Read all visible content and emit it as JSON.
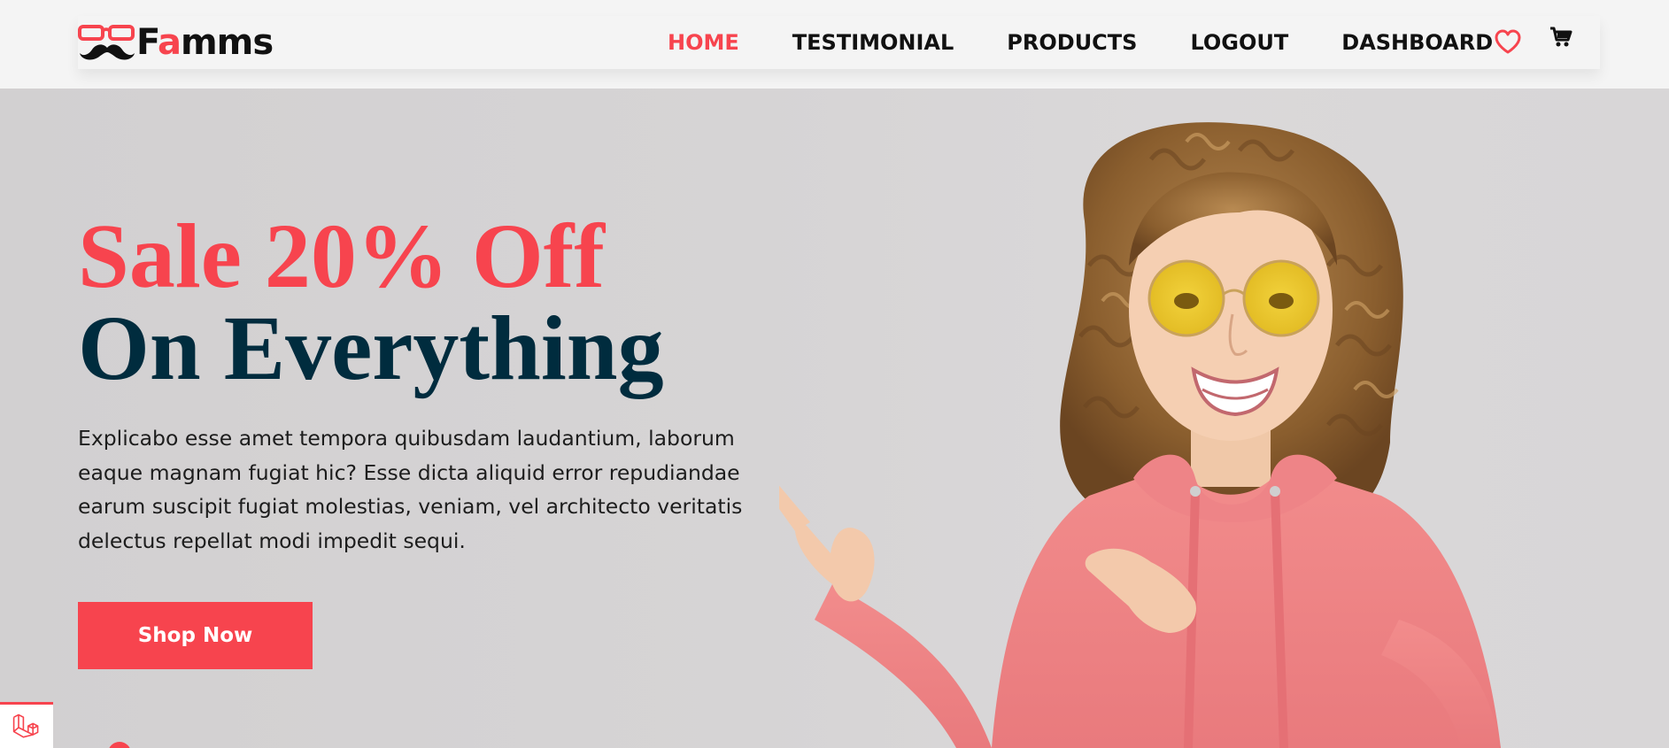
{
  "brand": {
    "name_prefix": "F",
    "name_accent": "a",
    "name_suffix": "mms",
    "logo_icon": "glasses-mustache-icon"
  },
  "nav": {
    "items": [
      {
        "label": "HOME",
        "active": true
      },
      {
        "label": "TESTIMONIAL",
        "active": false
      },
      {
        "label": "PRODUCTS",
        "active": false
      },
      {
        "label": "LOGOUT",
        "active": false
      },
      {
        "label": "DASHBOARD",
        "active": false
      }
    ],
    "icons": [
      "heart-icon",
      "cart-icon"
    ]
  },
  "hero": {
    "title_line1": "Sale 20% Off",
    "title_line2": "On Everything",
    "description": "Explicabo esse amet tempora quibusdam laudantium, laborum eaque magnam fugiat hic? Esse dicta aliquid error repudiandae earum suscipit fugiat molestias, veniam, vel architecto veritatis delectus repellat modi impedit sequi.",
    "cta_label": "Shop Now"
  },
  "colors": {
    "accent": "#f7444e",
    "heading_dark": "#002c3e",
    "hero_background": "#d6d4d5",
    "header_background": "#f4f4f4"
  },
  "debug_badge_icon": "laravel-logo-icon"
}
